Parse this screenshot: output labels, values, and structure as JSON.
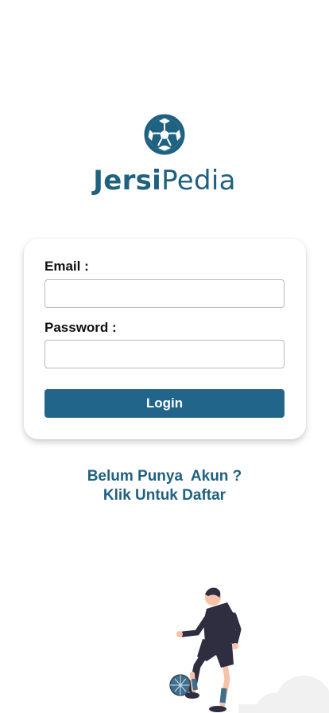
{
  "brand": {
    "part1": "Jersi",
    "part2": "Pedia"
  },
  "form": {
    "email_label": "Email :",
    "email_value": "",
    "password_label": "Password :",
    "password_value": "",
    "login_label": "Login"
  },
  "register": {
    "line1": "Belum Punya  Akun ?",
    "line2": "Klik Untuk Daftar"
  },
  "icons": {
    "logo": "soccer-ball-icon",
    "illustration": "football-player-illustration"
  },
  "colors": {
    "primary": "#22658a",
    "brand_text": "#1f6180",
    "background": "#ffffff"
  }
}
